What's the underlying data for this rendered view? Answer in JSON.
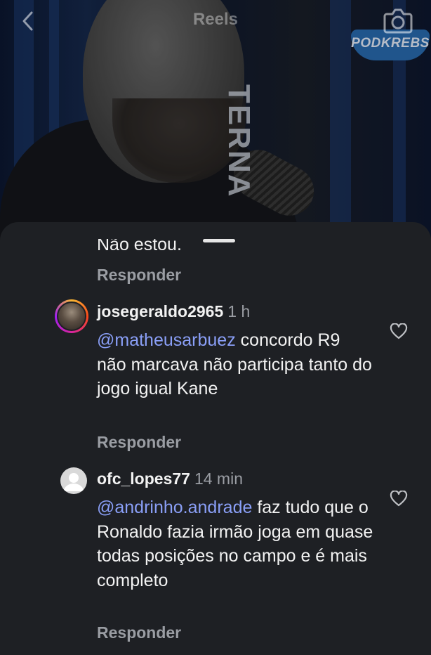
{
  "header": {
    "title": "Reels"
  },
  "video": {
    "overlay_text": "TERNA",
    "badge_text": "PODKREBS"
  },
  "comments_sheet": {
    "partial_prev_text": "Não estou.",
    "reply_label": "Responder",
    "comments": [
      {
        "username": "josegeraldo2965",
        "time": "1 h",
        "mention": "@matheusarbuez",
        "text_line1_rest": " concordo",
        "text_rest": "R9 não marcava não participa tanto do jogo igual Kane",
        "reply_label": "Responder"
      },
      {
        "username": "ofc_lopes77",
        "time": "14 min",
        "mention": "@andrinho.andrade",
        "text_line1_rest": " faz tudo",
        "text_rest": "que o Ronaldo fazia irmão joga em quase todas posições no campo e é mais completo",
        "reply_label": "Responder"
      }
    ]
  },
  "colors": {
    "sheet_bg": "#1e2024",
    "mention": "#8a9ff7",
    "secondary_text": "#9a9da3"
  }
}
